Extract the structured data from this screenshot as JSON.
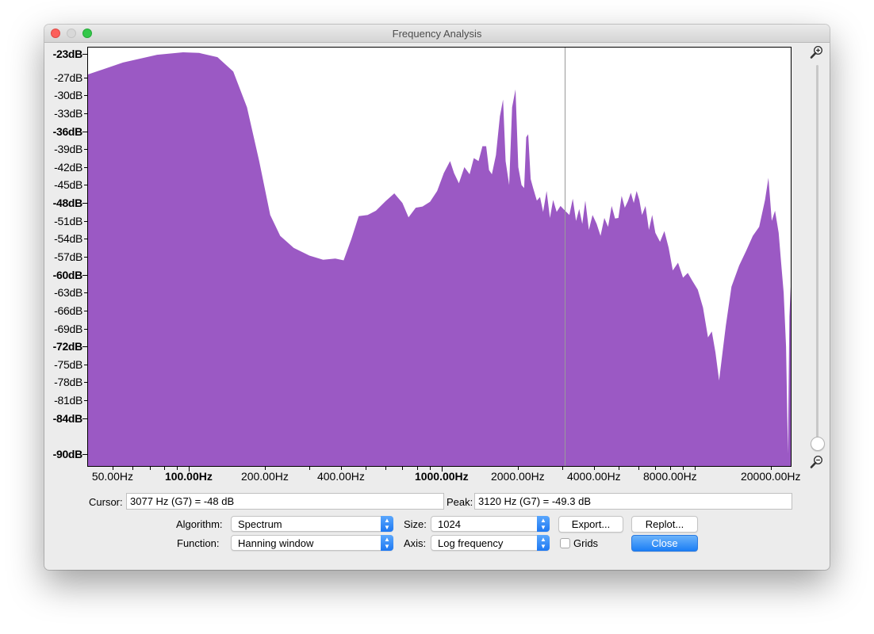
{
  "window": {
    "title": "Frequency Analysis"
  },
  "chart_data": {
    "type": "area",
    "fill_color": "#9b59c4",
    "xscale": "log",
    "xlim": [
      40,
      24000
    ],
    "ylim": [
      -92,
      -22
    ],
    "y_ticks": [
      {
        "value": -23,
        "label": "-23dB",
        "major": true
      },
      {
        "value": -27,
        "label": "-27dB",
        "major": false
      },
      {
        "value": -30,
        "label": "-30dB",
        "major": false
      },
      {
        "value": -33,
        "label": "-33dB",
        "major": false
      },
      {
        "value": -36,
        "label": "-36dB",
        "major": true
      },
      {
        "value": -39,
        "label": "-39dB",
        "major": false
      },
      {
        "value": -42,
        "label": "-42dB",
        "major": false
      },
      {
        "value": -45,
        "label": "-45dB",
        "major": false
      },
      {
        "value": -48,
        "label": "-48dB",
        "major": true
      },
      {
        "value": -51,
        "label": "-51dB",
        "major": false
      },
      {
        "value": -54,
        "label": "-54dB",
        "major": false
      },
      {
        "value": -57,
        "label": "-57dB",
        "major": false
      },
      {
        "value": -60,
        "label": "-60dB",
        "major": true
      },
      {
        "value": -63,
        "label": "-63dB",
        "major": false
      },
      {
        "value": -66,
        "label": "-66dB",
        "major": false
      },
      {
        "value": -69,
        "label": "-69dB",
        "major": false
      },
      {
        "value": -72,
        "label": "-72dB",
        "major": true
      },
      {
        "value": -75,
        "label": "-75dB",
        "major": false
      },
      {
        "value": -78,
        "label": "-78dB",
        "major": false
      },
      {
        "value": -81,
        "label": "-81dB",
        "major": false
      },
      {
        "value": -84,
        "label": "-84dB",
        "major": true
      },
      {
        "value": -90,
        "label": "-90dB",
        "major": true
      }
    ],
    "x_ticks": [
      {
        "value": 50,
        "label": "50.00Hz",
        "major": false
      },
      {
        "value": 100,
        "label": "100.00Hz",
        "major": true
      },
      {
        "value": 200,
        "label": "200.00Hz",
        "major": false
      },
      {
        "value": 400,
        "label": "400.00Hz",
        "major": false
      },
      {
        "value": 1000,
        "label": "1000.00Hz",
        "major": true
      },
      {
        "value": 2000,
        "label": "2000.00Hz",
        "major": false
      },
      {
        "value": 4000,
        "label": "4000.00Hz",
        "major": false
      },
      {
        "value": 8000,
        "label": "8000.00Hz",
        "major": false
      },
      {
        "value": 20000,
        "label": "20000.00Hz",
        "major": false
      }
    ],
    "minor_x_ticks": [
      60,
      70,
      80,
      90,
      300,
      500,
      600,
      700,
      800,
      900,
      3000,
      5000,
      6000,
      7000,
      9000,
      10000
    ],
    "cursor_line_hz": 3077,
    "points": [
      [
        40,
        -26.5
      ],
      [
        55,
        -24.5
      ],
      [
        75,
        -23.2
      ],
      [
        95,
        -22.8
      ],
      [
        110,
        -22.9
      ],
      [
        130,
        -23.6
      ],
      [
        150,
        -26
      ],
      [
        170,
        -32
      ],
      [
        190,
        -41
      ],
      [
        210,
        -50
      ],
      [
        230,
        -53.5
      ],
      [
        260,
        -55.5
      ],
      [
        300,
        -56.8
      ],
      [
        340,
        -57.5
      ],
      [
        380,
        -57.3
      ],
      [
        410,
        -57.6
      ],
      [
        440,
        -54
      ],
      [
        470,
        -50.2
      ],
      [
        510,
        -50
      ],
      [
        550,
        -49.3
      ],
      [
        600,
        -47.7
      ],
      [
        650,
        -46.4
      ],
      [
        700,
        -48
      ],
      [
        740,
        -50.4
      ],
      [
        790,
        -48.8
      ],
      [
        840,
        -48.6
      ],
      [
        900,
        -47.8
      ],
      [
        960,
        -46
      ],
      [
        1020,
        -43
      ],
      [
        1080,
        -41
      ],
      [
        1120,
        -43
      ],
      [
        1170,
        -44.7
      ],
      [
        1230,
        -42
      ],
      [
        1290,
        -43.2
      ],
      [
        1340,
        -40.5
      ],
      [
        1400,
        -41
      ],
      [
        1450,
        -38.5
      ],
      [
        1500,
        -38.5
      ],
      [
        1540,
        -42.5
      ],
      [
        1580,
        -43.2
      ],
      [
        1640,
        -40
      ],
      [
        1700,
        -33.5
      ],
      [
        1750,
        -30.7
      ],
      [
        1790,
        -41
      ],
      [
        1850,
        -45
      ],
      [
        1900,
        -32
      ],
      [
        1960,
        -29
      ],
      [
        2010,
        -42
      ],
      [
        2070,
        -45
      ],
      [
        2120,
        -45.5
      ],
      [
        2160,
        -37
      ],
      [
        2200,
        -36.5
      ],
      [
        2250,
        -44
      ],
      [
        2300,
        -45.5
      ],
      [
        2380,
        -47.6
      ],
      [
        2450,
        -47
      ],
      [
        2520,
        -49.5
      ],
      [
        2600,
        -46
      ],
      [
        2680,
        -50.5
      ],
      [
        2760,
        -47.5
      ],
      [
        2850,
        -49.5
      ],
      [
        2950,
        -48.5
      ],
      [
        3077,
        -49.3
      ],
      [
        3200,
        -50
      ],
      [
        3300,
        -47.3
      ],
      [
        3400,
        -51
      ],
      [
        3500,
        -49
      ],
      [
        3600,
        -51.5
      ],
      [
        3700,
        -47.6
      ],
      [
        3820,
        -52.5
      ],
      [
        3950,
        -50
      ],
      [
        4100,
        -51.5
      ],
      [
        4250,
        -53.5
      ],
      [
        4400,
        -50.5
      ],
      [
        4550,
        -52
      ],
      [
        4700,
        -48.5
      ],
      [
        4850,
        -50.6
      ],
      [
        5000,
        -50.5
      ],
      [
        5150,
        -46.8
      ],
      [
        5300,
        -48.8
      ],
      [
        5450,
        -47.7
      ],
      [
        5600,
        -46.3
      ],
      [
        5750,
        -48
      ],
      [
        5900,
        -46
      ],
      [
        6050,
        -47.5
      ],
      [
        6200,
        -50
      ],
      [
        6400,
        -48.5
      ],
      [
        6600,
        -52.5
      ],
      [
        6800,
        -50
      ],
      [
        7000,
        -53
      ],
      [
        7300,
        -54.5
      ],
      [
        7600,
        -52.7
      ],
      [
        7900,
        -55.5
      ],
      [
        8200,
        -59.3
      ],
      [
        8600,
        -58
      ],
      [
        9000,
        -60.5
      ],
      [
        9400,
        -59.7
      ],
      [
        9800,
        -61
      ],
      [
        10300,
        -62.5
      ],
      [
        10800,
        -65.5
      ],
      [
        11300,
        -70.5
      ],
      [
        11700,
        -69.5
      ],
      [
        12100,
        -73
      ],
      [
        12500,
        -77.7
      ],
      [
        12900,
        -73
      ],
      [
        13300,
        -68.5
      ],
      [
        14000,
        -62
      ],
      [
        15000,
        -58.5
      ],
      [
        16000,
        -56
      ],
      [
        17000,
        -53.5
      ],
      [
        18000,
        -52
      ],
      [
        19000,
        -47.5
      ],
      [
        19600,
        -43.8
      ],
      [
        20200,
        -51
      ],
      [
        20800,
        -49.3
      ],
      [
        21500,
        -53
      ],
      [
        22000,
        -58
      ],
      [
        22500,
        -63
      ],
      [
        23000,
        -72
      ],
      [
        23400,
        -90
      ],
      [
        23700,
        -67
      ],
      [
        24000,
        -62
      ]
    ]
  },
  "cursor": {
    "label": "Cursor:",
    "value": "3077 Hz (G7) = -48 dB"
  },
  "peak": {
    "label": "Peak:",
    "value": "3120 Hz (G7) = -49.3 dB"
  },
  "controls": {
    "algorithm_label": "Algorithm:",
    "algorithm_value": "Spectrum",
    "size_label": "Size:",
    "size_value": "1024",
    "function_label": "Function:",
    "function_value": "Hanning window",
    "axis_label": "Axis:",
    "axis_value": "Log frequency",
    "grids_label": "Grids",
    "grids_checked": false,
    "export_label": "Export...",
    "replot_label": "Replot...",
    "close_label": "Close"
  },
  "icons": {
    "zoom_in": "zoom-in-icon",
    "zoom_out": "zoom-out-icon"
  }
}
